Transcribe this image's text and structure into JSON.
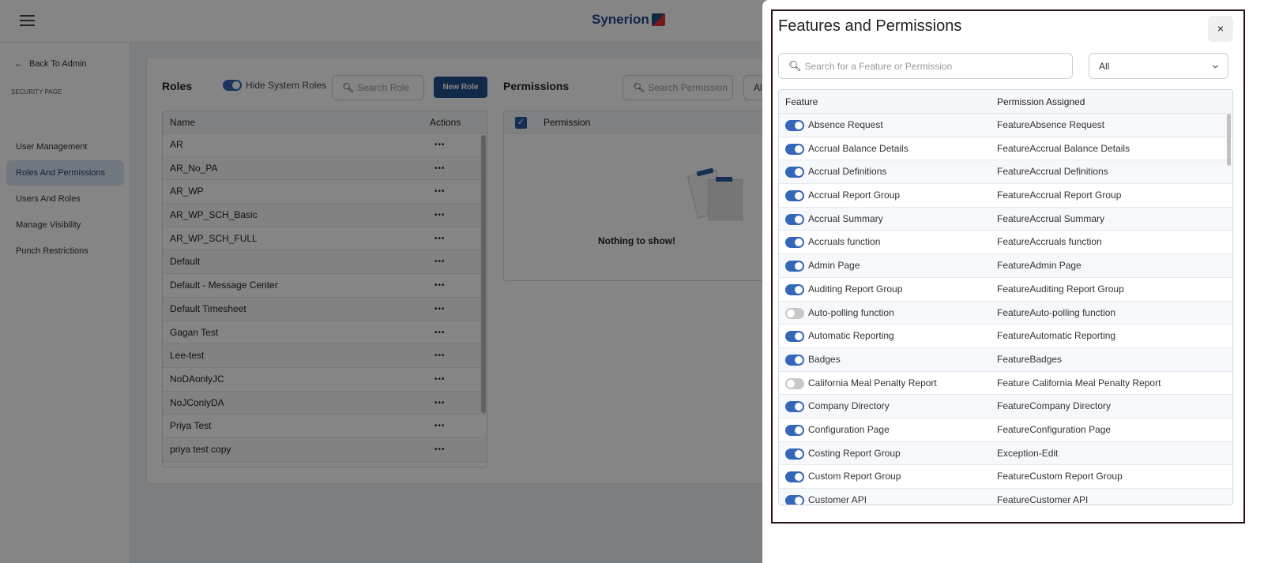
{
  "header": {
    "logo": "Synerion"
  },
  "sidebar": {
    "back": "Back To Admin",
    "section": "SECURITY PAGE",
    "items": [
      {
        "label": "User Management",
        "active": false
      },
      {
        "label": "Roles And Permissions",
        "active": true
      },
      {
        "label": "Users And Roles",
        "active": false
      },
      {
        "label": "Manage Visibility",
        "active": false
      },
      {
        "label": "Punch Restrictions",
        "active": false
      }
    ]
  },
  "roles": {
    "title": "Roles",
    "toggle_label": "Hide System Roles",
    "toggle_on": true,
    "search_placeholder": "Search Role",
    "new_button": "New Role",
    "col_name": "Name",
    "col_actions": "Actions",
    "actions_glyph": "•••",
    "rows": [
      "AR",
      "AR_No_PA",
      "AR_WP",
      "AR_WP_SCH_Basic",
      "AR_WP_SCH_FULL",
      "Default",
      "Default - Message Center",
      "Default Timesheet",
      "Gagan Test",
      "Lee-test",
      "NoDAonlyJC",
      "NoJConlyDA",
      "Priya Test",
      "priya test copy"
    ]
  },
  "permissions": {
    "title": "Permissions",
    "search_placeholder": "Search Permission",
    "filter": "All",
    "col_permission": "Permission",
    "empty": "Nothing to show!"
  },
  "modal": {
    "title": "Features and Permissions",
    "close": "×",
    "search_placeholder": "Search for a Feature or Permission",
    "filter": "All",
    "col_feature": "Feature",
    "col_permission": "Permission Assigned",
    "rows": [
      {
        "feature": "Absence Request",
        "permission": "FeatureAbsence Request",
        "on": true
      },
      {
        "feature": "Accrual Balance Details",
        "permission": "FeatureAccrual Balance Details",
        "on": true
      },
      {
        "feature": "Accrual Definitions",
        "permission": "FeatureAccrual Definitions",
        "on": true
      },
      {
        "feature": "Accrual Report Group",
        "permission": "FeatureAccrual Report Group",
        "on": true
      },
      {
        "feature": "Accrual Summary",
        "permission": "FeatureAccrual Summary",
        "on": true
      },
      {
        "feature": "Accruals function",
        "permission": "FeatureAccruals function",
        "on": true
      },
      {
        "feature": "Admin Page",
        "permission": "FeatureAdmin Page",
        "on": true
      },
      {
        "feature": "Auditing Report Group",
        "permission": "FeatureAuditing Report Group",
        "on": true
      },
      {
        "feature": "Auto-polling function",
        "permission": "FeatureAuto-polling function",
        "on": false
      },
      {
        "feature": "Automatic Reporting",
        "permission": "FeatureAutomatic Reporting",
        "on": true
      },
      {
        "feature": "Badges",
        "permission": "FeatureBadges",
        "on": true
      },
      {
        "feature": "California Meal Penalty Report",
        "permission": "Feature California Meal Penalty Report",
        "on": false
      },
      {
        "feature": "Company Directory",
        "permission": "FeatureCompany Directory",
        "on": true
      },
      {
        "feature": "Configuration Page",
        "permission": "FeatureConfiguration Page",
        "on": true
      },
      {
        "feature": "Costing Report Group",
        "permission": "Exception-Edit",
        "on": true
      },
      {
        "feature": "Custom Report Group",
        "permission": "FeatureCustom Report Group",
        "on": true
      },
      {
        "feature": "Customer API",
        "permission": "FeatureCustomer API",
        "on": true
      }
    ]
  }
}
